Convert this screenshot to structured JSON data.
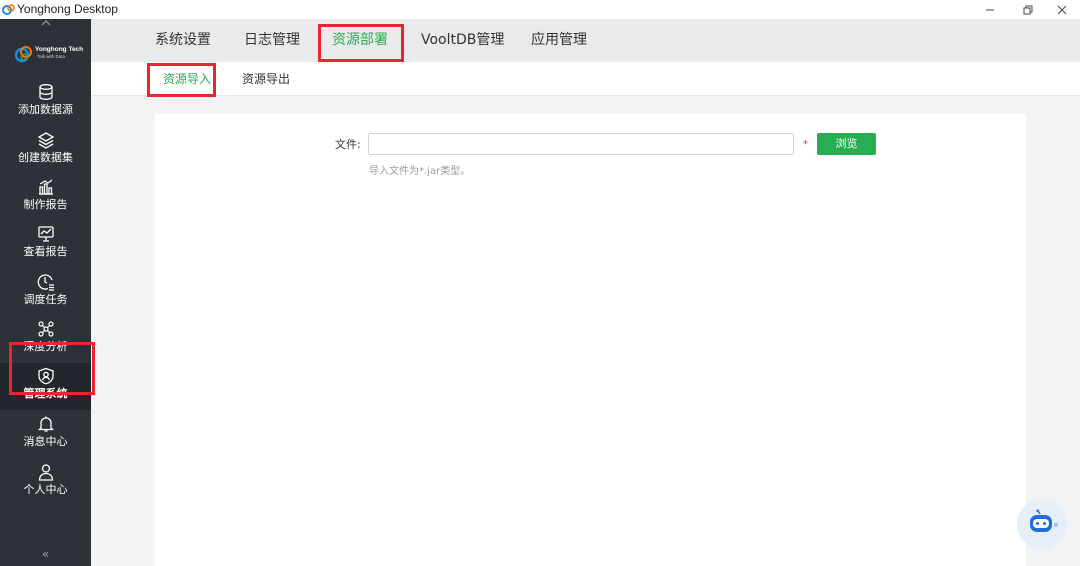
{
  "window": {
    "title": "Yonghong Desktop",
    "minimize": "—",
    "close": "✕"
  },
  "logo": {
    "name": "Yonghong Tech",
    "tagline": "Talk with Data"
  },
  "sidebar": {
    "items": [
      {
        "label": "添加数据源",
        "icon": "database-icon"
      },
      {
        "label": "创建数据集",
        "icon": "layers-icon"
      },
      {
        "label": "制作报告",
        "icon": "bar-chart-icon"
      },
      {
        "label": "查看报告",
        "icon": "monitor-chart-icon"
      },
      {
        "label": "调度任务",
        "icon": "clock-list-icon"
      },
      {
        "label": "深度分析",
        "icon": "network-icon"
      },
      {
        "label": "管理系统",
        "icon": "shield-user-icon",
        "active": true
      },
      {
        "label": "消息中心",
        "icon": "bell-icon"
      },
      {
        "label": "个人中心",
        "icon": "user-icon"
      }
    ],
    "collapse": "«"
  },
  "topnav": {
    "tabs": [
      {
        "label": "系统设置"
      },
      {
        "label": "日志管理"
      },
      {
        "label": "资源部署",
        "active": true
      },
      {
        "label": "VooltDB管理"
      },
      {
        "label": "应用管理"
      }
    ]
  },
  "subnav": {
    "tabs": [
      {
        "label": "资源导入",
        "active": true
      },
      {
        "label": "资源导出"
      }
    ]
  },
  "form": {
    "file_label": "文件:",
    "file_value": "",
    "required": "*",
    "browse_label": "浏览",
    "hint": "导入文件为*.jar类型。"
  },
  "colors": {
    "accent": "#27ae52",
    "sidebar": "#2e3138",
    "highlight": "#e8262d"
  }
}
